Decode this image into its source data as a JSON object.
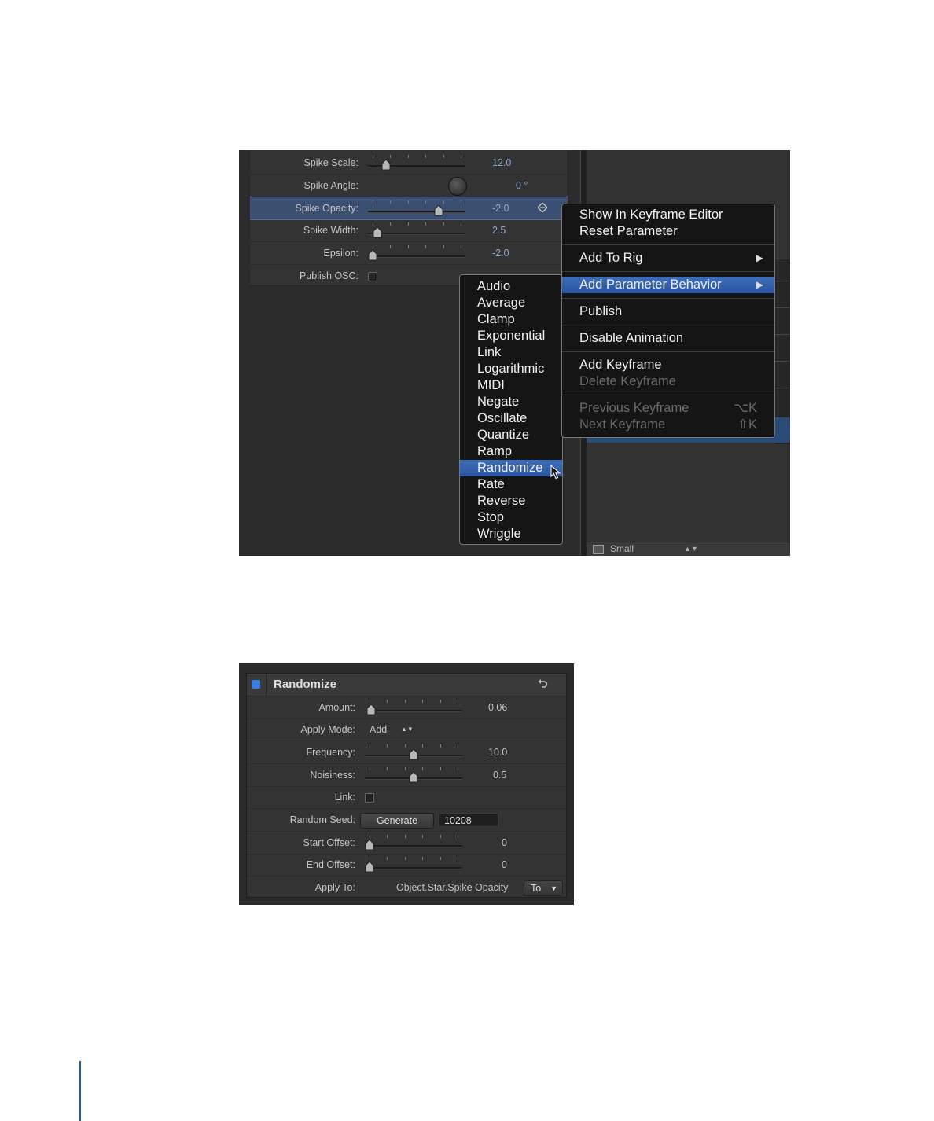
{
  "inspector": {
    "rows": [
      {
        "label": "Spike Scale:",
        "value": "12.0",
        "slider": 0.15
      },
      {
        "label": "Spike Angle:",
        "value": "0 °"
      },
      {
        "label": "Spike Opacity:",
        "value": "-2.0",
        "slider": 0.75
      },
      {
        "label": "Spike Width:",
        "value": "2.5",
        "slider": 0.05
      },
      {
        "label": "Epsilon:",
        "value": "-2.0",
        "slider": 0.0
      },
      {
        "label": "Publish OSC:"
      }
    ]
  },
  "context_menu": {
    "items": [
      {
        "label": "Show In Keyframe Editor"
      },
      {
        "label": "Reset Parameter"
      },
      {
        "label": "Add To Rig",
        "submenu": true
      },
      {
        "label": "Add Parameter Behavior",
        "submenu": true,
        "highlighted": true
      },
      {
        "label": "Publish"
      },
      {
        "label": "Disable Animation"
      },
      {
        "label": "Add Keyframe"
      },
      {
        "label": "Delete Keyframe",
        "disabled": true
      },
      {
        "label": "Previous Keyframe",
        "disabled": true,
        "shortcut": "⌥K"
      },
      {
        "label": "Next Keyframe",
        "disabled": true,
        "shortcut": "⇧K"
      }
    ]
  },
  "behavior_submenu": {
    "items": [
      "Audio",
      "Average",
      "Clamp",
      "Exponential",
      "Link",
      "Logarithmic",
      "MIDI",
      "Negate",
      "Oscillate",
      "Quantize",
      "Ramp",
      "Randomize",
      "Rate",
      "Reverse",
      "Stop",
      "Wriggle"
    ],
    "highlighted": "Randomize"
  },
  "footer": {
    "size_label": "Small",
    "size_arrows": "▲▼"
  },
  "randomize": {
    "title": "Randomize",
    "enabled_color": "#3b7de0",
    "amount": {
      "label": "Amount:",
      "value": "0.06",
      "slider": 0.02
    },
    "apply_mode": {
      "label": "Apply Mode:",
      "value": "Add",
      "arrows": "▲▼"
    },
    "frequency": {
      "label": "Frequency:",
      "value": "10.0",
      "slider": 0.5
    },
    "noisiness": {
      "label": "Noisiness:",
      "value": "0.5",
      "slider": 0.5
    },
    "link": {
      "label": "Link:"
    },
    "random_seed": {
      "label": "Random Seed:",
      "button": "Generate",
      "value": "10208"
    },
    "start_offset": {
      "label": "Start Offset:",
      "value": "0",
      "slider": 0.0
    },
    "end_offset": {
      "label": "End Offset:",
      "value": "0",
      "slider": 0.0
    },
    "apply_to": {
      "label": "Apply To:",
      "value": "Object.Star.Spike Opacity",
      "popup": "To"
    }
  },
  "colors": {
    "highlight": "#2a55a0",
    "value_blue": "#8fa6cc"
  }
}
